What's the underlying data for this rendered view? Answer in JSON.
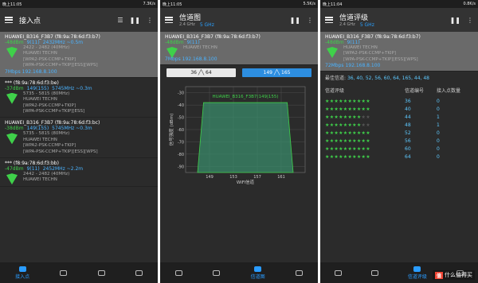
{
  "screens": [
    {
      "status_time": "晚上11:05",
      "status_right": "7.3K/s",
      "title": "接入点",
      "ap_list": [
        {
          "head": "HUAWEI_B316_F3B7 (f8:9a:78:6d:f3:b7)",
          "signal": "-48dBm",
          "channel": "9(11)",
          "freq": "2432MHz ~0.5m",
          "range": "2422 - 2482 (40MHz)",
          "vendor": "HUAWEI TECHN",
          "sec1": "[WPA2-PSK-CCMP+TKIP]",
          "sec2": "[WPA-PSK-CCMP+TKIP][ESS][WPS]",
          "speed": "7Mbps 192.168.8.100",
          "hl": true
        },
        {
          "head": "*** (f8:9a:78:6d:f3:be)",
          "signal": "-37dBm",
          "channel": "149(155)",
          "freq": "5745MHz ~0.3m",
          "range": "5735 - 5815 (80MHz)",
          "vendor": "HUAWEI TECHN",
          "sec1": "[WPA2-PSK-CCMP+TKIP]",
          "sec2": "[WPA-PSK-CCMP+TKIP][ESS]",
          "speed": "",
          "hl": false
        },
        {
          "head": "HUAWEI_B316_F3B7 (f8:9a:78:6d:f3:bc)",
          "signal": "-38dBm",
          "channel": "149(155)",
          "freq": "5745MHz ~0.3m",
          "range": "5735 - 5815 (80MHz)",
          "vendor": "HUAWEI TECHN",
          "sec1": "[WPA2-PSK-CCMP+TKIP]",
          "sec2": "[WPA-PSK-CCMP+TKIP][ESS][WPS]",
          "speed": "",
          "hl": false
        },
        {
          "head": "*** (f8:9a:78:6d:f3:bb)",
          "signal": "-47dBm",
          "channel": "9(11)",
          "freq": "2452MHz ~2.2m",
          "range": "2442 - 2482 (40MHz)",
          "vendor": "HUAWEI TECHN",
          "sec1": "",
          "sec2": "",
          "speed": "",
          "hl": false
        }
      ],
      "nav_labels": [
        "接入点",
        "",
        "",
        ""
      ]
    },
    {
      "status_time": "晚上11:05",
      "status_right": "5.5K/s",
      "title": "信道图",
      "band_24": "2.4 GHz",
      "band_5": "5 GHz",
      "ap_head": "HUAWEI_B316_F3B7 (f8:9a:78:6d:f3:b7)",
      "ap_signal": "-48dBm",
      "ap_channel": "9(11)",
      "ap_vendor": "HUAWEI TECHN",
      "ap_speed": "7Mbps 192.168.8.100",
      "tab_left": "36 ╱╲ 64",
      "tab_right": "149 ╱╲ 165",
      "chart_label": "HUAWEI_B316_F3B7(149|155)",
      "nav_label": "信道图"
    },
    {
      "status_time": "晚上11:04",
      "status_right": "0.8K/s",
      "title": "信道评级",
      "band_24": "2.4 GHz",
      "band_5": "5 GHz",
      "ap_head": "HUAWEI_B316_F3B7 (f8:9a:78:6d:f3:b7)",
      "ap_signal": "-48dBm",
      "ap_channel": "9(11)",
      "ap_vendor": "HUAWEI TECHN",
      "ap_sec1": "[WPA2-PSK-CCMP+TKIP]",
      "ap_sec2": "[WPA-PSK-CCMP+TKIP][ESS][WPS]",
      "ap_speed": "72Mbps 192.168.8.100",
      "best_label": "最佳信道:",
      "best_values": "36, 40, 52, 56, 60, 64, 165, 44, 48",
      "col_rating": "信道评级",
      "col_channel": "信道编号",
      "col_count": "接入点数量",
      "rows": [
        {
          "stars": 10,
          "ch": "36",
          "cnt": "0"
        },
        {
          "stars": 10,
          "ch": "40",
          "cnt": "0"
        },
        {
          "stars": 8,
          "ch": "44",
          "cnt": "1"
        },
        {
          "stars": 8,
          "ch": "48",
          "cnt": "1"
        },
        {
          "stars": 10,
          "ch": "52",
          "cnt": "0"
        },
        {
          "stars": 10,
          "ch": "56",
          "cnt": "0"
        },
        {
          "stars": 10,
          "ch": "60",
          "cnt": "0"
        },
        {
          "stars": 10,
          "ch": "64",
          "cnt": "0"
        }
      ],
      "nav_label": "信道评级"
    }
  ],
  "logo_text": "什么值得买",
  "chart_data": {
    "type": "area",
    "title": "HUAWEI_B316_F3B7(149|155)",
    "xlabel": "WiFi信道",
    "ylabel": "信号强度 (dBm)",
    "x_ticks": [
      149,
      153,
      157,
      161
    ],
    "y_ticks": [
      -30,
      -40,
      -50,
      -60,
      -70,
      -80,
      -90
    ],
    "xlim": [
      145,
      165
    ],
    "ylim": [
      -95,
      -25
    ],
    "series": [
      {
        "name": "HUAWEI_B316_F3B7",
        "x": [
          147,
          148,
          162,
          163
        ],
        "y": [
          -95,
          -38,
          -38,
          -95
        ]
      }
    ]
  }
}
